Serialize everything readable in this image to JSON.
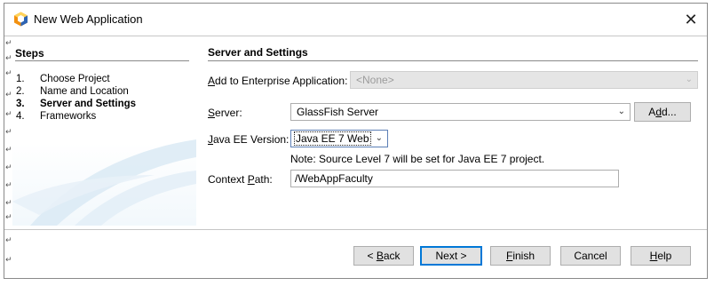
{
  "window": {
    "title": "New Web Application",
    "close_glyph": "✕"
  },
  "steps": {
    "header": "Steps",
    "items": [
      {
        "num": "1.",
        "label": "Choose Project",
        "current": false
      },
      {
        "num": "2.",
        "label": "Name and Location",
        "current": false
      },
      {
        "num": "3.",
        "label": "Server and Settings",
        "current": true
      },
      {
        "num": "4.",
        "label": "Frameworks",
        "current": false
      }
    ]
  },
  "main": {
    "header": "Server and Settings",
    "enterprise": {
      "label_u": "A",
      "label_rest": "dd to Enterprise Application:",
      "value": "<None>",
      "enabled": false
    },
    "server": {
      "label_u": "S",
      "label_rest": "erver:",
      "value": "GlassFish Server",
      "add_button_pre": "A",
      "add_button_u": "d",
      "add_button_post": "d..."
    },
    "javaee": {
      "label_u": "J",
      "label_rest": "ava EE Version:",
      "value": "Java EE 7 Web"
    },
    "note": "Note: Source Level 7 will be set for Java EE 7 project.",
    "context": {
      "label_pre": "Context ",
      "label_u": "P",
      "label_rest": "ath:",
      "value": "/WebAppFaculty"
    }
  },
  "buttons": {
    "back": {
      "pre": "< ",
      "u": "B",
      "post": "ack"
    },
    "next": {
      "label": "Next >"
    },
    "finish": {
      "u": "F",
      "post": "inish"
    },
    "cancel": {
      "label": "Cancel"
    },
    "help": {
      "u": "H",
      "post": "elp"
    }
  },
  "paragraph_mark": "↵",
  "colors": {
    "default_button_border": "#0078d7",
    "button_face": "#e1e1e1",
    "accent_blue": "#5c7fb6"
  }
}
